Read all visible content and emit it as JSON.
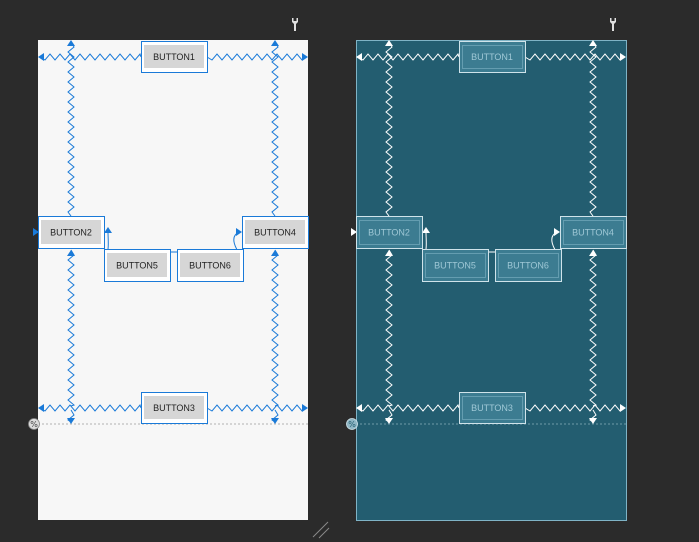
{
  "design_view": {
    "buttons": [
      {
        "id": "b1",
        "label": "BUTTON1"
      },
      {
        "id": "b2",
        "label": "BUTTON2"
      },
      {
        "id": "b3",
        "label": "BUTTON3"
      },
      {
        "id": "b4",
        "label": "BUTTON4"
      },
      {
        "id": "b5",
        "label": "BUTTON5"
      },
      {
        "id": "b6",
        "label": "BUTTON6"
      }
    ]
  },
  "blueprint_view": {
    "buttons": [
      {
        "id": "b1",
        "label": "BUTTON1"
      },
      {
        "id": "b2",
        "label": "BUTTON2"
      },
      {
        "id": "b3",
        "label": "BUTTON3"
      },
      {
        "id": "b4",
        "label": "BUTTON4"
      },
      {
        "id": "b5",
        "label": "BUTTON5"
      },
      {
        "id": "b6",
        "label": "BUTTON6"
      }
    ]
  },
  "icons": {
    "wrench": "wrench-icon",
    "percent_guide": "percent-guideline-icon",
    "resize": "resize-handle-icon"
  },
  "colors": {
    "workspace": "#2b2b2b",
    "design_bg": "#f7f7f7",
    "blueprint_bg": "#235d70",
    "constraint_design": "#1a7ad8",
    "constraint_blueprint": "#ffffff",
    "button_face": "#d6d6d6"
  }
}
